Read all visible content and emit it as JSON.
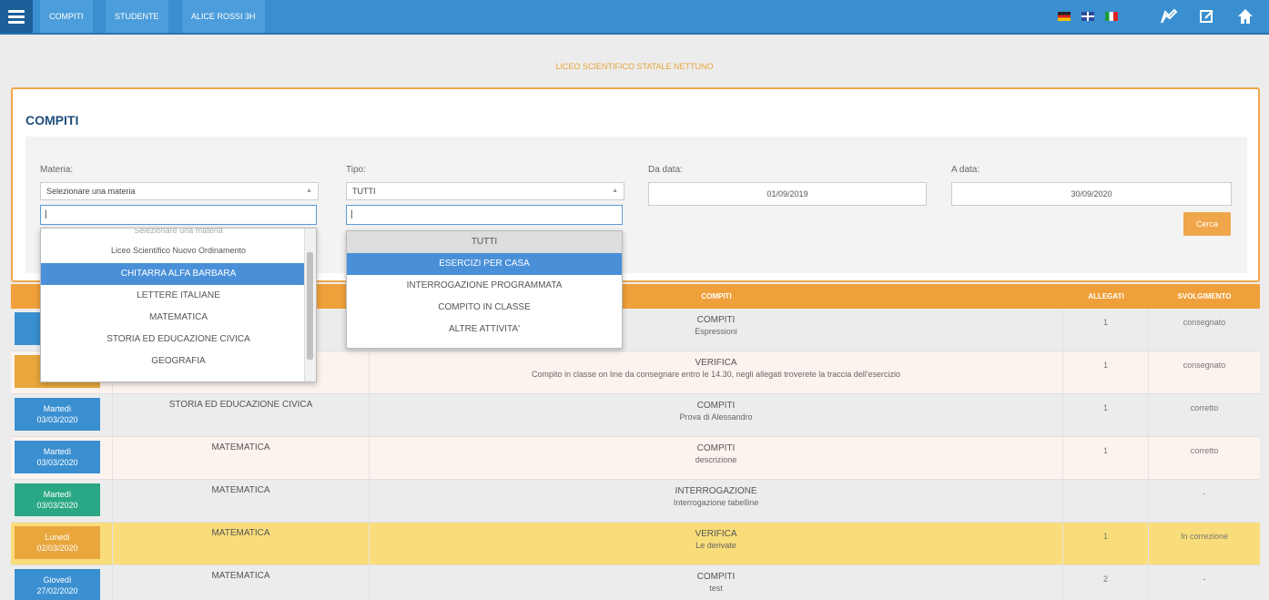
{
  "nav": {
    "crumbs": [
      "COMPITI",
      "STUDENTE",
      "ALICE ROSSI 3H"
    ],
    "flags": [
      "de-flag",
      "uk-flag",
      "it-flag"
    ]
  },
  "header": {
    "school": "LICEO SCIENTIFICO STATALE NETTUNO"
  },
  "panel": {
    "title": "COMPITI"
  },
  "filters": {
    "materia_label": "Materia:",
    "materia_value": "Selezionare una materia",
    "tipo_label": "Tipo:",
    "tipo_value": "TUTTI",
    "da_label": "Da data:",
    "da_value": "01/09/2019",
    "a_label": "A data:",
    "a_value": "30/09/2020",
    "search_button": "Cerca"
  },
  "materia_dropdown": {
    "search_value": "|",
    "options": [
      "Selezionare una materia",
      "Liceo Scientifico Nuovo Ordinamento",
      "CHITARRA ALFA BARBARA",
      "LETTERE ITALIANE",
      "MATEMATICA",
      "STORIA ED EDUCAZIONE CIVICA",
      "GEOGRAFIA"
    ],
    "highlighted": "CHITARRA ALFA BARBARA"
  },
  "tipo_dropdown": {
    "search_value": "|",
    "options": [
      "TUTTI",
      "ESERCIZI PER CASA",
      "INTERROGAZIONE PROGRAMMATA",
      "COMPITO IN CLASSE",
      "ALTRE ATTIVITA'"
    ],
    "selected": "TUTTI",
    "highlighted": "ESERCIZI PER CASA"
  },
  "table": {
    "headers": {
      "compiti": "COMPITI",
      "allegati": "ALLEGATI",
      "svolgimento": "SVOLGIMENTO"
    },
    "rows": [
      {
        "day": "",
        "date": "",
        "subject": "",
        "type": "COMPITI",
        "desc": "Espressioni",
        "allegati": "1",
        "status": "consegnato",
        "badge_color": "#3a8fd0",
        "bg": "#ffffff"
      },
      {
        "day": "",
        "date": "",
        "subject": "",
        "type": "VERIFICA",
        "desc": "Compito in classe on line da consegnare entro le 14.30, negli allegati troverete la traccia dell'esercizio",
        "allegati": "1",
        "status": "consegnato",
        "badge_color": "#e8a63c",
        "bg": "#fdf3ee"
      },
      {
        "day": "Martedì",
        "date": "03/03/2020",
        "subject": "STORIA ED EDUCAZIONE CIVICA",
        "type": "COMPITI",
        "desc": "Prova di Alessandro",
        "allegati": "1",
        "status": "corretto",
        "badge_color": "#3a8fd0",
        "bg": "#ffffff"
      },
      {
        "day": "Martedì",
        "date": "03/03/2020",
        "subject": "MATEMATICA",
        "type": "COMPITI",
        "desc": "descrizione",
        "allegati": "1",
        "status": "corretto",
        "badge_color": "#3a8fd0",
        "bg": "#fdf3ee"
      },
      {
        "day": "Martedì",
        "date": "03/03/2020",
        "subject": "MATEMATICA",
        "type": "INTERROGAZIONE",
        "desc": "Interrogazione tabelline",
        "allegati": "",
        "status": "-",
        "badge_color": "#2aa784",
        "bg": "#ffffff"
      },
      {
        "day": "Lunedì",
        "date": "02/03/2020",
        "subject": "MATEMATICA",
        "type": "VERIFICA",
        "desc": "Le derivate",
        "allegati": "1",
        "status": "In correzione",
        "badge_color": "#e8a63c",
        "bg": "#f9dd7a"
      },
      {
        "day": "Giovedì",
        "date": "27/02/2020",
        "subject": "MATEMATICA",
        "type": "COMPITI",
        "desc": "test",
        "allegati": "2",
        "status": "-",
        "badge_color": "#3a8fd0",
        "bg": "#ffffff"
      }
    ]
  }
}
